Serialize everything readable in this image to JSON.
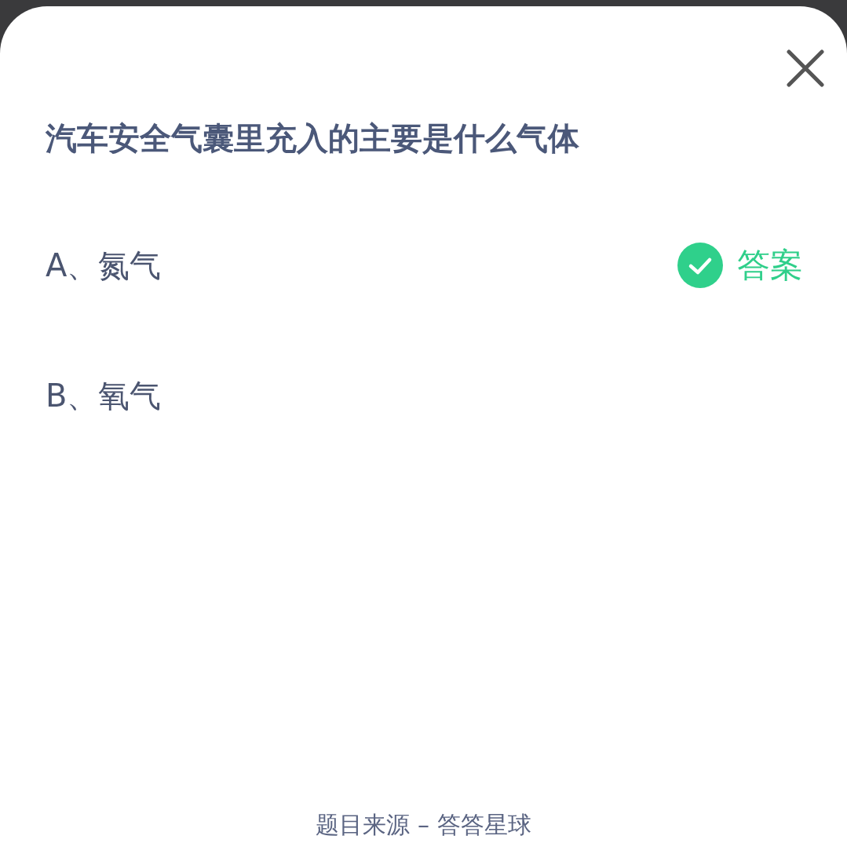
{
  "question": "汽车安全气囊里充入的主要是什么气体",
  "options": [
    {
      "label": "A、氮气",
      "correct": true
    },
    {
      "label": "B、氧气",
      "correct": false
    }
  ],
  "answer_tag": "答案",
  "footer": "题目来源 – 答答星球"
}
